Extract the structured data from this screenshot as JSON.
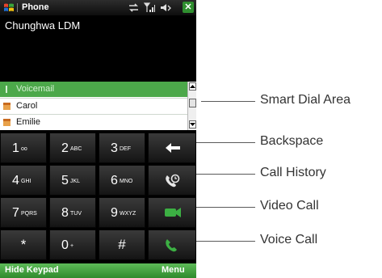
{
  "title_bar": {
    "app_name": "Phone",
    "icons": [
      "windows-start-icon",
      "connectivity-icon",
      "signal-icon",
      "speaker-icon",
      "close-icon"
    ],
    "close_label": "✕"
  },
  "caller_name": "Chunghwa LDM",
  "smart_dial": {
    "items": [
      {
        "icon": "voicemail-icon",
        "label": "Voicemail",
        "selected": true
      },
      {
        "icon": "contact-icon",
        "label": "Carol",
        "selected": false
      },
      {
        "icon": "contact-icon",
        "label": "Emilie",
        "selected": false
      }
    ]
  },
  "keypad": {
    "rows": [
      [
        {
          "digit": "1",
          "letters": "oo"
        },
        {
          "digit": "2",
          "letters": "ABC"
        },
        {
          "digit": "3",
          "letters": "DEF"
        },
        {
          "icon": "backspace-icon"
        }
      ],
      [
        {
          "digit": "4",
          "letters": "GHI"
        },
        {
          "digit": "5",
          "letters": "JKL"
        },
        {
          "digit": "6",
          "letters": "MNO"
        },
        {
          "icon": "call-history-icon"
        }
      ],
      [
        {
          "digit": "7",
          "letters": "PQRS"
        },
        {
          "digit": "8",
          "letters": "TUV"
        },
        {
          "digit": "9",
          "letters": "WXYZ"
        },
        {
          "icon": "video-call-icon"
        }
      ],
      [
        {
          "symbol": "*"
        },
        {
          "digit": "0",
          "letters": "+"
        },
        {
          "symbol": "#"
        },
        {
          "icon": "voice-call-icon"
        }
      ]
    ]
  },
  "soft_keys": {
    "left": "Hide Keypad",
    "right": "Menu"
  },
  "callouts": {
    "smart_dial": "Smart Dial Area",
    "backspace": "Backspace",
    "call_history": "Call History",
    "video_call": "Video Call",
    "voice_call": "Voice Call"
  },
  "colors": {
    "accent_green": "#4ca84a",
    "softbar_green": "#3a9a36",
    "keypad_bg": "#000000"
  }
}
